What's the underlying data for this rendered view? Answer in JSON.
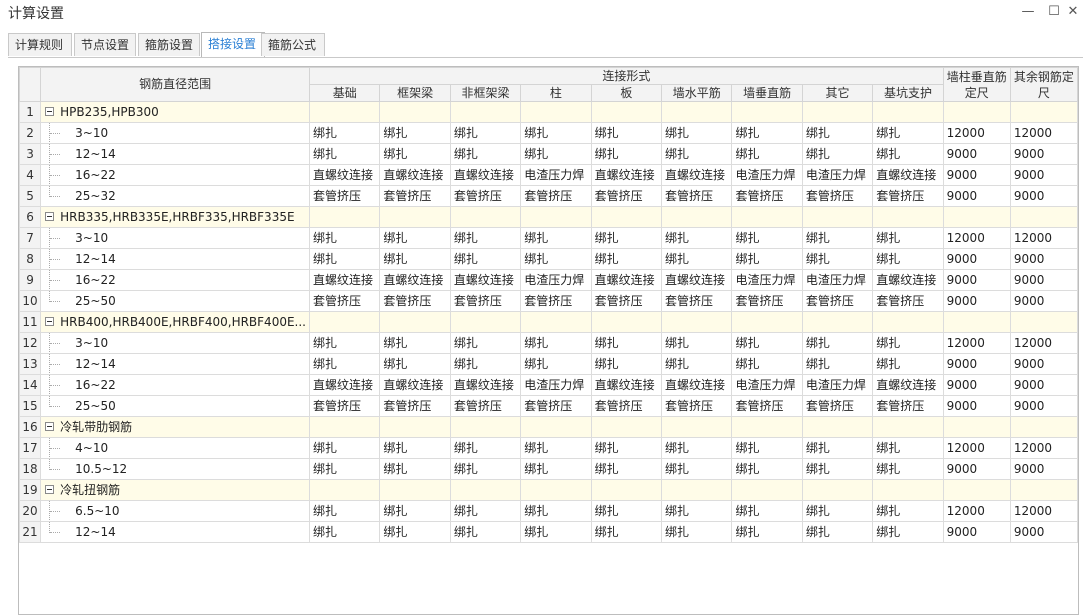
{
  "window": {
    "title": "计算设置",
    "minimize_glyph": "—",
    "maximize_glyph": "☐",
    "close_glyph": "✕"
  },
  "tabs": [
    {
      "label": "计算规则",
      "active": false
    },
    {
      "label": "节点设置",
      "active": false
    },
    {
      "label": "箍筋设置",
      "active": false
    },
    {
      "label": "搭接设置",
      "active": true
    },
    {
      "label": "箍筋公式",
      "active": false
    }
  ],
  "table": {
    "header": {
      "diameter_range": "钢筋直径范围",
      "connection_form": "连接形式",
      "columns": [
        "基础",
        "框架梁",
        "非框架梁",
        "柱",
        "板",
        "墙水平筋",
        "墙垂直筋",
        "其它",
        "基坑支护"
      ],
      "wall_col_length": "墙柱垂直筋定尺",
      "other_length": "其余钢筋定尺"
    },
    "rows": [
      {
        "num": "1",
        "type": "group",
        "name": "HPB235,HPB300"
      },
      {
        "num": "2",
        "type": "child",
        "name": "3~10",
        "cells": [
          "绑扎",
          "绑扎",
          "绑扎",
          "绑扎",
          "绑扎",
          "绑扎",
          "绑扎",
          "绑扎",
          "绑扎"
        ],
        "wall_col": "12000",
        "other": "12000"
      },
      {
        "num": "3",
        "type": "child",
        "name": "12~14",
        "cells": [
          "绑扎",
          "绑扎",
          "绑扎",
          "绑扎",
          "绑扎",
          "绑扎",
          "绑扎",
          "绑扎",
          "绑扎"
        ],
        "wall_col": "9000",
        "other": "9000"
      },
      {
        "num": "4",
        "type": "child",
        "name": "16~22",
        "cells": [
          "直螺纹连接",
          "直螺纹连接",
          "直螺纹连接",
          "电渣压力焊",
          "直螺纹连接",
          "直螺纹连接",
          "电渣压力焊",
          "电渣压力焊",
          "直螺纹连接"
        ],
        "wall_col": "9000",
        "other": "9000"
      },
      {
        "num": "5",
        "type": "child",
        "last": true,
        "name": "25~32",
        "cells": [
          "套管挤压",
          "套管挤压",
          "套管挤压",
          "套管挤压",
          "套管挤压",
          "套管挤压",
          "套管挤压",
          "套管挤压",
          "套管挤压"
        ],
        "wall_col": "9000",
        "other": "9000"
      },
      {
        "num": "6",
        "type": "group",
        "name": "HRB335,HRB335E,HRBF335,HRBF335E"
      },
      {
        "num": "7",
        "type": "child",
        "name": "3~10",
        "cells": [
          "绑扎",
          "绑扎",
          "绑扎",
          "绑扎",
          "绑扎",
          "绑扎",
          "绑扎",
          "绑扎",
          "绑扎"
        ],
        "wall_col": "12000",
        "other": "12000"
      },
      {
        "num": "8",
        "type": "child",
        "name": "12~14",
        "cells": [
          "绑扎",
          "绑扎",
          "绑扎",
          "绑扎",
          "绑扎",
          "绑扎",
          "绑扎",
          "绑扎",
          "绑扎"
        ],
        "wall_col": "9000",
        "other": "9000"
      },
      {
        "num": "9",
        "type": "child",
        "name": "16~22",
        "cells": [
          "直螺纹连接",
          "直螺纹连接",
          "直螺纹连接",
          "电渣压力焊",
          "直螺纹连接",
          "直螺纹连接",
          "电渣压力焊",
          "电渣压力焊",
          "直螺纹连接"
        ],
        "wall_col": "9000",
        "other": "9000"
      },
      {
        "num": "10",
        "type": "child",
        "last": true,
        "name": "25~50",
        "cells": [
          "套管挤压",
          "套管挤压",
          "套管挤压",
          "套管挤压",
          "套管挤压",
          "套管挤压",
          "套管挤压",
          "套管挤压",
          "套管挤压"
        ],
        "wall_col": "9000",
        "other": "9000"
      },
      {
        "num": "11",
        "type": "group",
        "name": "HRB400,HRB400E,HRBF400,HRBF400E..."
      },
      {
        "num": "12",
        "type": "child",
        "name": "3~10",
        "cells": [
          "绑扎",
          "绑扎",
          "绑扎",
          "绑扎",
          "绑扎",
          "绑扎",
          "绑扎",
          "绑扎",
          "绑扎"
        ],
        "wall_col": "12000",
        "other": "12000"
      },
      {
        "num": "13",
        "type": "child",
        "name": "12~14",
        "cells": [
          "绑扎",
          "绑扎",
          "绑扎",
          "绑扎",
          "绑扎",
          "绑扎",
          "绑扎",
          "绑扎",
          "绑扎"
        ],
        "wall_col": "9000",
        "other": "9000"
      },
      {
        "num": "14",
        "type": "child",
        "name": "16~22",
        "cells": [
          "直螺纹连接",
          "直螺纹连接",
          "直螺纹连接",
          "电渣压力焊",
          "直螺纹连接",
          "直螺纹连接",
          "电渣压力焊",
          "电渣压力焊",
          "直螺纹连接"
        ],
        "wall_col": "9000",
        "other": "9000"
      },
      {
        "num": "15",
        "type": "child",
        "last": true,
        "name": "25~50",
        "cells": [
          "套管挤压",
          "套管挤压",
          "套管挤压",
          "套管挤压",
          "套管挤压",
          "套管挤压",
          "套管挤压",
          "套管挤压",
          "套管挤压"
        ],
        "wall_col": "9000",
        "other": "9000"
      },
      {
        "num": "16",
        "type": "group",
        "name": "冷轧带肋钢筋"
      },
      {
        "num": "17",
        "type": "child",
        "name": "4~10",
        "cells": [
          "绑扎",
          "绑扎",
          "绑扎",
          "绑扎",
          "绑扎",
          "绑扎",
          "绑扎",
          "绑扎",
          "绑扎"
        ],
        "wall_col": "12000",
        "other": "12000"
      },
      {
        "num": "18",
        "type": "child",
        "last": true,
        "name": "10.5~12",
        "cells": [
          "绑扎",
          "绑扎",
          "绑扎",
          "绑扎",
          "绑扎",
          "绑扎",
          "绑扎",
          "绑扎",
          "绑扎"
        ],
        "wall_col": "9000",
        "other": "9000"
      },
      {
        "num": "19",
        "type": "group",
        "name": "冷轧扭钢筋"
      },
      {
        "num": "20",
        "type": "child",
        "name": "6.5~10",
        "cells": [
          "绑扎",
          "绑扎",
          "绑扎",
          "绑扎",
          "绑扎",
          "绑扎",
          "绑扎",
          "绑扎",
          "绑扎"
        ],
        "wall_col": "12000",
        "other": "12000"
      },
      {
        "num": "21",
        "type": "child",
        "last": true,
        "name": "12~14",
        "cells": [
          "绑扎",
          "绑扎",
          "绑扎",
          "绑扎",
          "绑扎",
          "绑扎",
          "绑扎",
          "绑扎",
          "绑扎"
        ],
        "wall_col": "9000",
        "other": "9000"
      }
    ]
  }
}
